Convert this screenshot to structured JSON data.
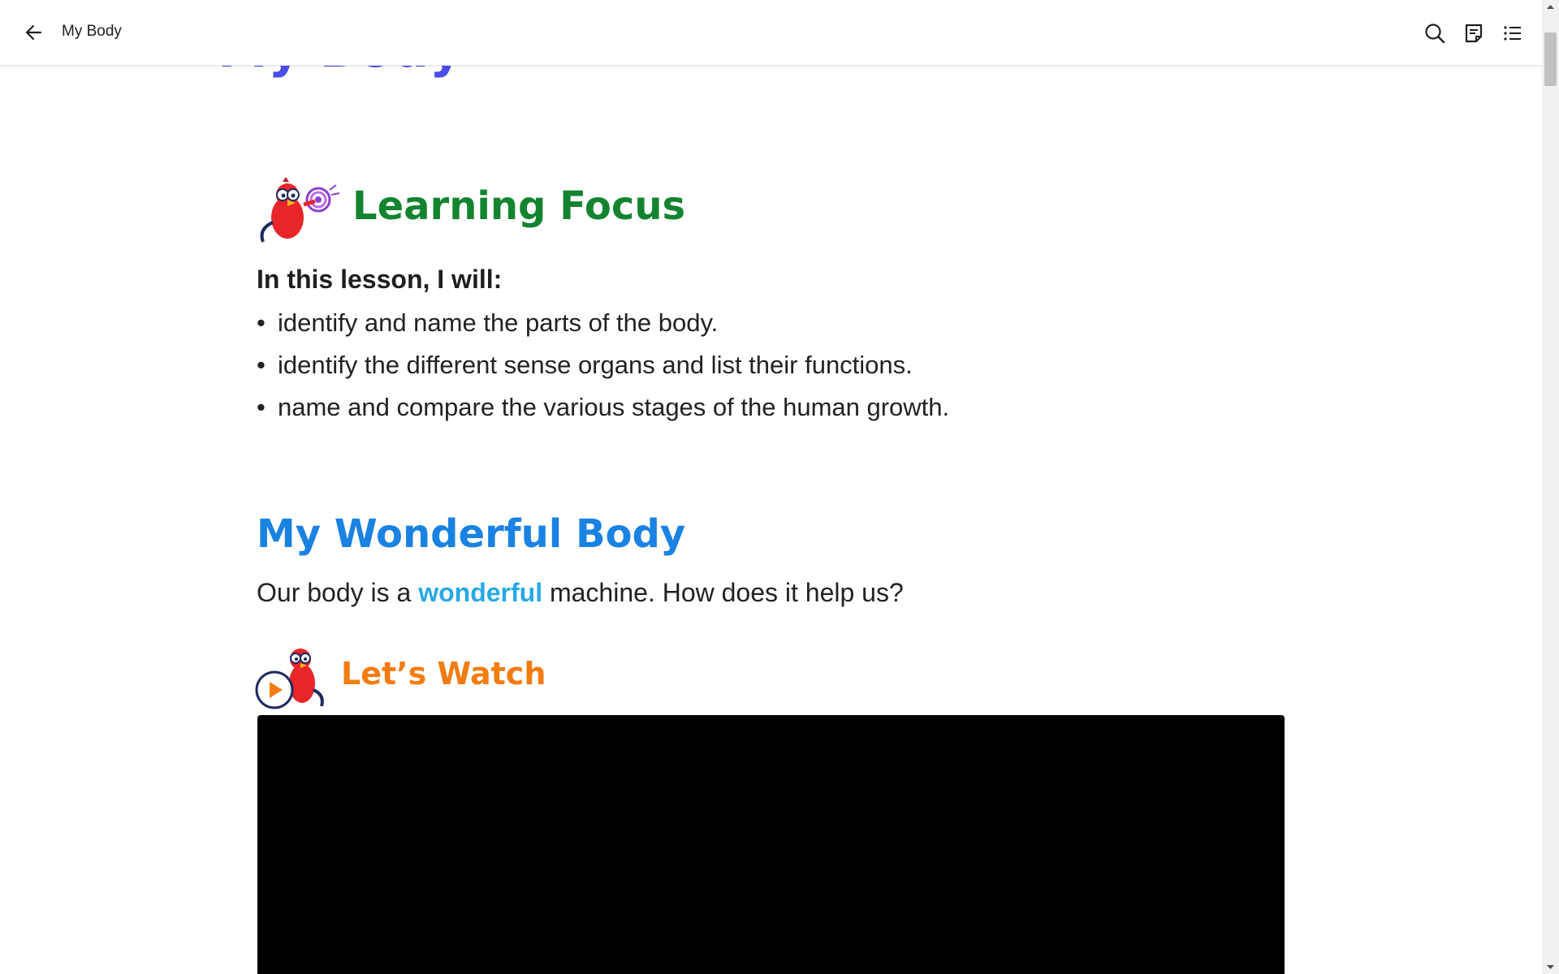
{
  "app_bar": {
    "title": "My Body",
    "icons": [
      "back-arrow-icon",
      "search-icon",
      "notes-icon",
      "list-icon"
    ]
  },
  "page": {
    "title": "My Body"
  },
  "learning_focus": {
    "heading": "Learning Focus",
    "intro": "In this lesson, I will:",
    "objectives": [
      "identify and name the parts of the body.",
      "identify the different sense organs and list their functions.",
      "name and compare the various stages of the human growth."
    ]
  },
  "wonderful_body": {
    "heading": "My Wonderful Body",
    "text_before": "Our body is a ",
    "highlight": "wonderful",
    "text_after": " machine. How does it help us?"
  },
  "lets_watch": {
    "heading": "Let’s Watch"
  },
  "colors": {
    "title": "#4b4de6",
    "learning_focus": "#13832f",
    "section": "#1a82e2",
    "highlight": "#27a8e6",
    "lets_watch": "#f27c12"
  }
}
